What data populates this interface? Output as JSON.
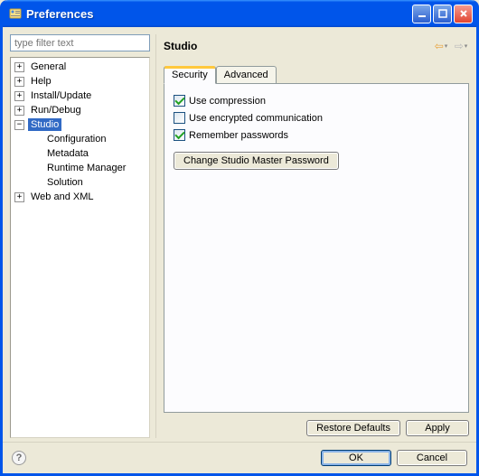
{
  "window": {
    "title": "Preferences"
  },
  "filter": {
    "placeholder": "type filter text"
  },
  "tree": {
    "items": [
      {
        "label": "General",
        "expanded": false,
        "hasChildren": true
      },
      {
        "label": "Help",
        "expanded": false,
        "hasChildren": true
      },
      {
        "label": "Install/Update",
        "expanded": false,
        "hasChildren": true
      },
      {
        "label": "Run/Debug",
        "expanded": false,
        "hasChildren": true
      },
      {
        "label": "Studio",
        "expanded": true,
        "hasChildren": true,
        "selected": true,
        "children": [
          {
            "label": "Configuration"
          },
          {
            "label": "Metadata"
          },
          {
            "label": "Runtime Manager"
          },
          {
            "label": "Solution"
          }
        ]
      },
      {
        "label": "Web and XML",
        "expanded": false,
        "hasChildren": true
      }
    ]
  },
  "page": {
    "title": "Studio",
    "tabs": [
      {
        "label": "Security",
        "active": true
      },
      {
        "label": "Advanced",
        "active": false
      }
    ],
    "options": {
      "use_compression": {
        "label": "Use compression",
        "checked": true
      },
      "use_encrypted": {
        "label": "Use encrypted communication",
        "checked": false
      },
      "remember_passwords": {
        "label": "Remember passwords",
        "checked": true
      }
    },
    "change_password_label": "Change Studio Master Password"
  },
  "buttons": {
    "restore_defaults": "Restore Defaults",
    "apply": "Apply",
    "ok": "OK",
    "cancel": "Cancel"
  }
}
